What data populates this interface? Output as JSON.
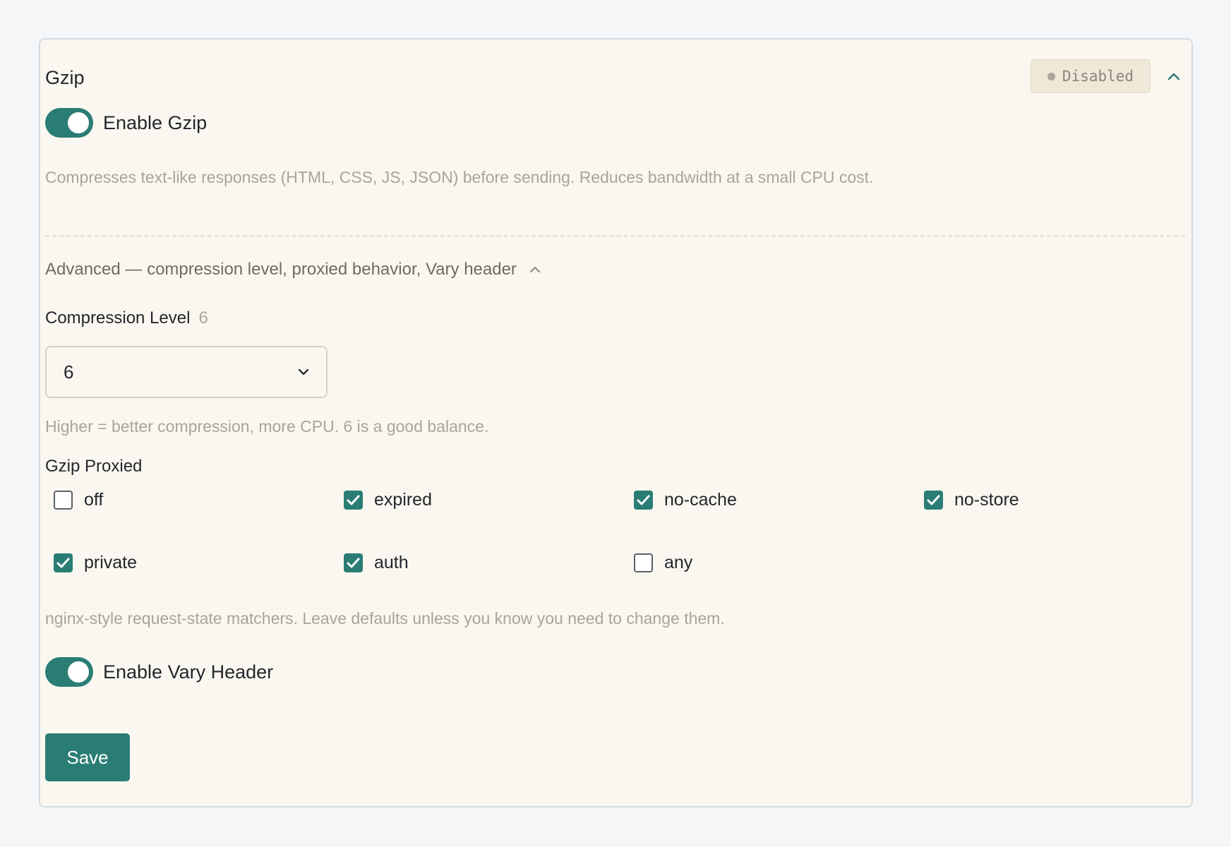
{
  "panel": {
    "title": "Gzip",
    "status_badge": "Disabled"
  },
  "gzip": {
    "enable_label": "Enable Gzip",
    "enabled": true,
    "description": "Compresses text-like responses (HTML, CSS, JS, JSON) before sending. Reduces bandwidth at a small CPU cost."
  },
  "advanced": {
    "toggle_label": "Advanced — compression level, proxied behavior, Vary header",
    "expanded": true
  },
  "compression": {
    "label": "Compression Level",
    "current_hint": "6",
    "selected_value": "6",
    "help": "Higher = better compression, more CPU. 6 is a good balance."
  },
  "proxied": {
    "label": "Gzip Proxied",
    "options": [
      {
        "label": "off",
        "checked": false
      },
      {
        "label": "expired",
        "checked": true
      },
      {
        "label": "no-cache",
        "checked": true
      },
      {
        "label": "no-store",
        "checked": true
      },
      {
        "label": "private",
        "checked": true
      },
      {
        "label": "auth",
        "checked": true
      },
      {
        "label": "any",
        "checked": false
      }
    ],
    "help": "nginx-style request-state matchers. Leave defaults unless you know you need to change them."
  },
  "vary": {
    "enable_label": "Enable Vary Header",
    "enabled": true
  },
  "actions": {
    "save_label": "Save"
  },
  "colors": {
    "accent": "#2a7d74",
    "panel_bg": "#faf7f0",
    "page_bg": "#f5f6f7",
    "muted_text": "#a9a49a"
  }
}
